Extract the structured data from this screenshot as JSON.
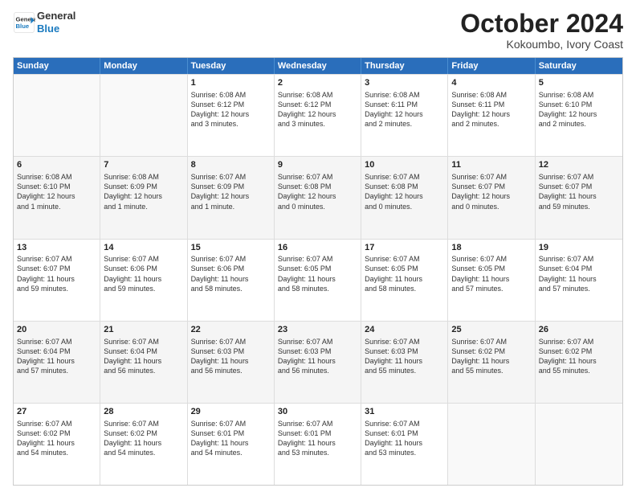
{
  "header": {
    "logo_line1": "General",
    "logo_line2": "Blue",
    "month_title": "October 2024",
    "subtitle": "Kokoumbo, Ivory Coast"
  },
  "days_of_week": [
    "Sunday",
    "Monday",
    "Tuesday",
    "Wednesday",
    "Thursday",
    "Friday",
    "Saturday"
  ],
  "weeks": [
    [
      {
        "day": "",
        "info": ""
      },
      {
        "day": "",
        "info": ""
      },
      {
        "day": "1",
        "info": "Sunrise: 6:08 AM\nSunset: 6:12 PM\nDaylight: 12 hours\nand 3 minutes."
      },
      {
        "day": "2",
        "info": "Sunrise: 6:08 AM\nSunset: 6:12 PM\nDaylight: 12 hours\nand 3 minutes."
      },
      {
        "day": "3",
        "info": "Sunrise: 6:08 AM\nSunset: 6:11 PM\nDaylight: 12 hours\nand 2 minutes."
      },
      {
        "day": "4",
        "info": "Sunrise: 6:08 AM\nSunset: 6:11 PM\nDaylight: 12 hours\nand 2 minutes."
      },
      {
        "day": "5",
        "info": "Sunrise: 6:08 AM\nSunset: 6:10 PM\nDaylight: 12 hours\nand 2 minutes."
      }
    ],
    [
      {
        "day": "6",
        "info": "Sunrise: 6:08 AM\nSunset: 6:10 PM\nDaylight: 12 hours\nand 1 minute."
      },
      {
        "day": "7",
        "info": "Sunrise: 6:08 AM\nSunset: 6:09 PM\nDaylight: 12 hours\nand 1 minute."
      },
      {
        "day": "8",
        "info": "Sunrise: 6:07 AM\nSunset: 6:09 PM\nDaylight: 12 hours\nand 1 minute."
      },
      {
        "day": "9",
        "info": "Sunrise: 6:07 AM\nSunset: 6:08 PM\nDaylight: 12 hours\nand 0 minutes."
      },
      {
        "day": "10",
        "info": "Sunrise: 6:07 AM\nSunset: 6:08 PM\nDaylight: 12 hours\nand 0 minutes."
      },
      {
        "day": "11",
        "info": "Sunrise: 6:07 AM\nSunset: 6:07 PM\nDaylight: 12 hours\nand 0 minutes."
      },
      {
        "day": "12",
        "info": "Sunrise: 6:07 AM\nSunset: 6:07 PM\nDaylight: 11 hours\nand 59 minutes."
      }
    ],
    [
      {
        "day": "13",
        "info": "Sunrise: 6:07 AM\nSunset: 6:07 PM\nDaylight: 11 hours\nand 59 minutes."
      },
      {
        "day": "14",
        "info": "Sunrise: 6:07 AM\nSunset: 6:06 PM\nDaylight: 11 hours\nand 59 minutes."
      },
      {
        "day": "15",
        "info": "Sunrise: 6:07 AM\nSunset: 6:06 PM\nDaylight: 11 hours\nand 58 minutes."
      },
      {
        "day": "16",
        "info": "Sunrise: 6:07 AM\nSunset: 6:05 PM\nDaylight: 11 hours\nand 58 minutes."
      },
      {
        "day": "17",
        "info": "Sunrise: 6:07 AM\nSunset: 6:05 PM\nDaylight: 11 hours\nand 58 minutes."
      },
      {
        "day": "18",
        "info": "Sunrise: 6:07 AM\nSunset: 6:05 PM\nDaylight: 11 hours\nand 57 minutes."
      },
      {
        "day": "19",
        "info": "Sunrise: 6:07 AM\nSunset: 6:04 PM\nDaylight: 11 hours\nand 57 minutes."
      }
    ],
    [
      {
        "day": "20",
        "info": "Sunrise: 6:07 AM\nSunset: 6:04 PM\nDaylight: 11 hours\nand 57 minutes."
      },
      {
        "day": "21",
        "info": "Sunrise: 6:07 AM\nSunset: 6:04 PM\nDaylight: 11 hours\nand 56 minutes."
      },
      {
        "day": "22",
        "info": "Sunrise: 6:07 AM\nSunset: 6:03 PM\nDaylight: 11 hours\nand 56 minutes."
      },
      {
        "day": "23",
        "info": "Sunrise: 6:07 AM\nSunset: 6:03 PM\nDaylight: 11 hours\nand 56 minutes."
      },
      {
        "day": "24",
        "info": "Sunrise: 6:07 AM\nSunset: 6:03 PM\nDaylight: 11 hours\nand 55 minutes."
      },
      {
        "day": "25",
        "info": "Sunrise: 6:07 AM\nSunset: 6:02 PM\nDaylight: 11 hours\nand 55 minutes."
      },
      {
        "day": "26",
        "info": "Sunrise: 6:07 AM\nSunset: 6:02 PM\nDaylight: 11 hours\nand 55 minutes."
      }
    ],
    [
      {
        "day": "27",
        "info": "Sunrise: 6:07 AM\nSunset: 6:02 PM\nDaylight: 11 hours\nand 54 minutes."
      },
      {
        "day": "28",
        "info": "Sunrise: 6:07 AM\nSunset: 6:02 PM\nDaylight: 11 hours\nand 54 minutes."
      },
      {
        "day": "29",
        "info": "Sunrise: 6:07 AM\nSunset: 6:01 PM\nDaylight: 11 hours\nand 54 minutes."
      },
      {
        "day": "30",
        "info": "Sunrise: 6:07 AM\nSunset: 6:01 PM\nDaylight: 11 hours\nand 53 minutes."
      },
      {
        "day": "31",
        "info": "Sunrise: 6:07 AM\nSunset: 6:01 PM\nDaylight: 11 hours\nand 53 minutes."
      },
      {
        "day": "",
        "info": ""
      },
      {
        "day": "",
        "info": ""
      }
    ]
  ]
}
